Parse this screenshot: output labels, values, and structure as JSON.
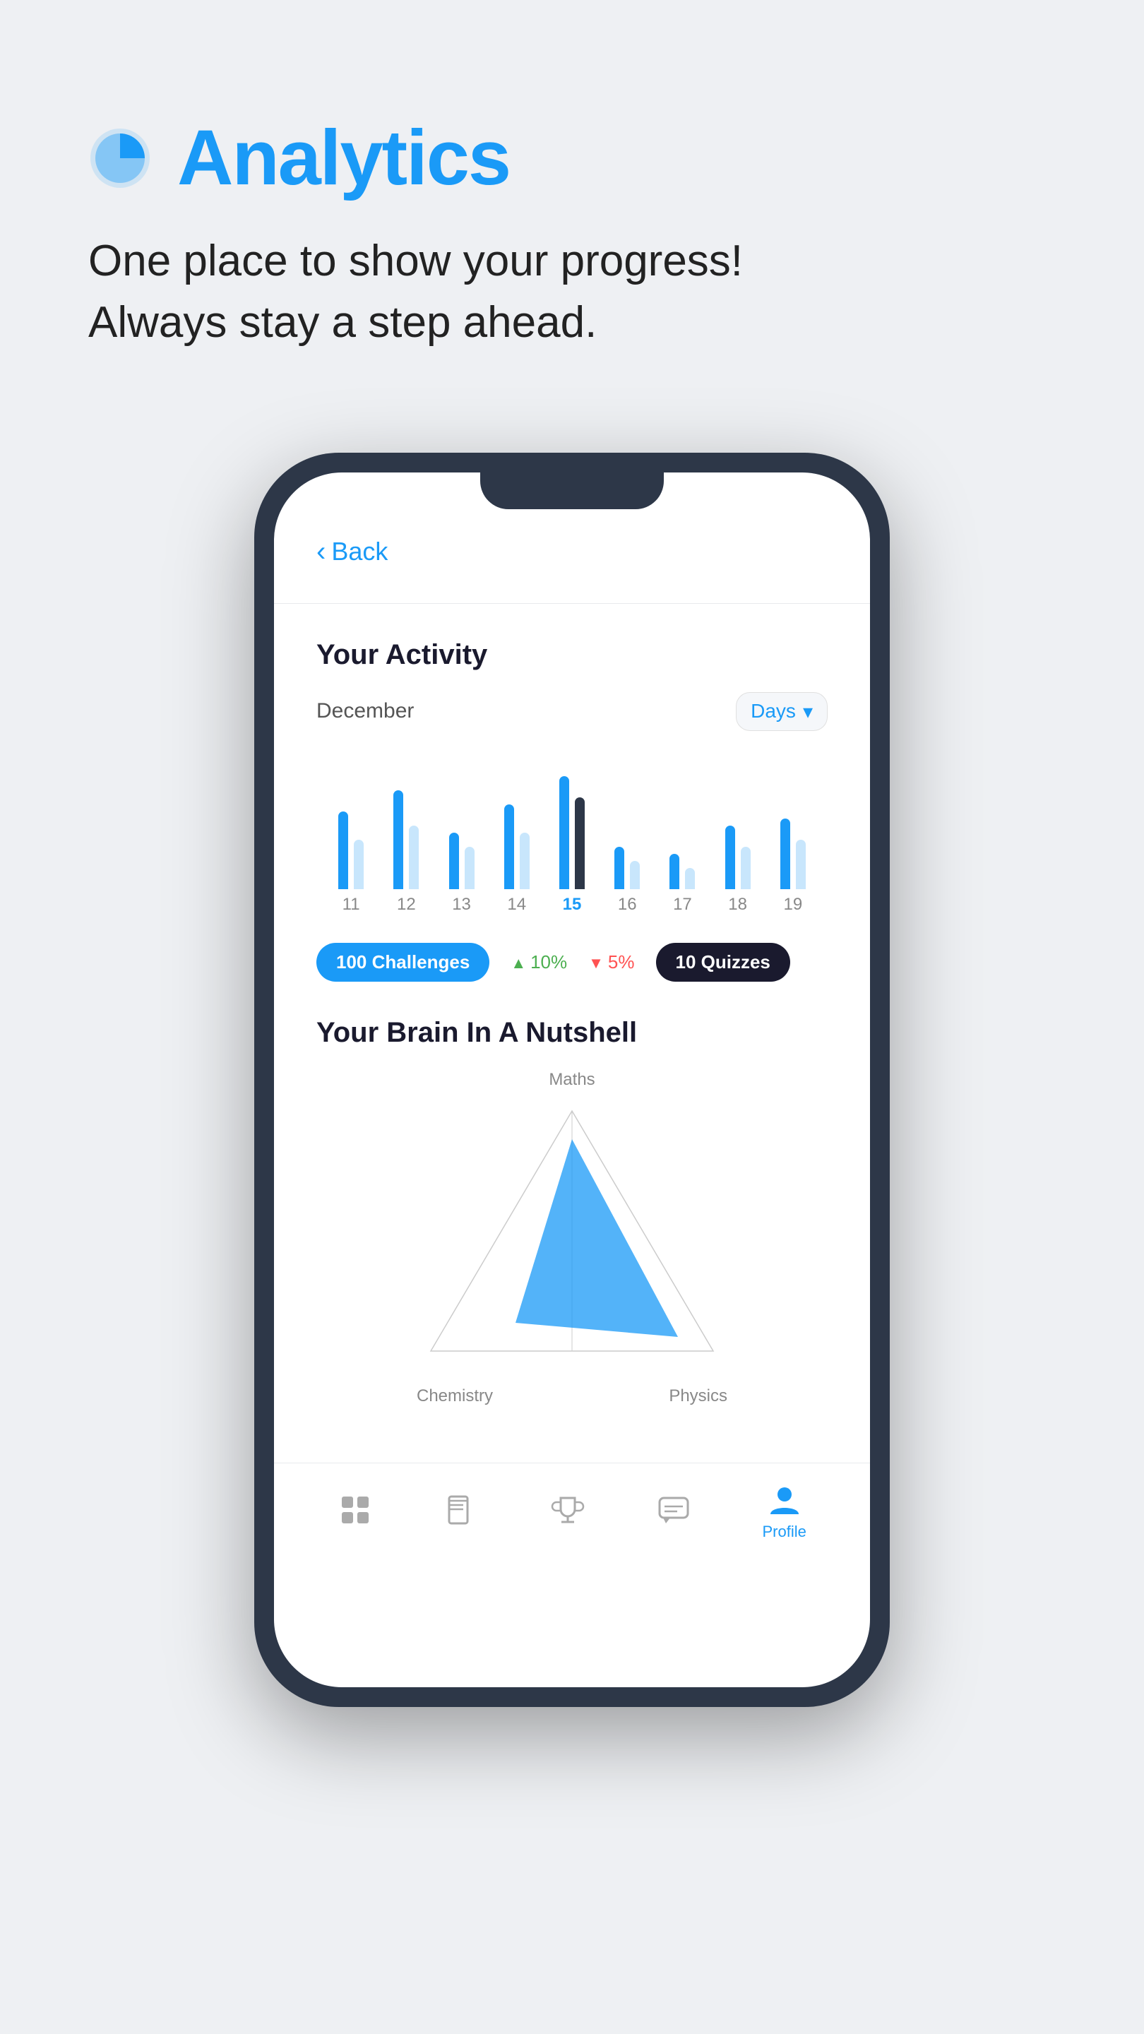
{
  "page": {
    "background": "#eef0f3"
  },
  "header": {
    "icon_label": "analytics-pie-icon",
    "title": "Analytics",
    "subtitle_line1": "One place to show your progress!",
    "subtitle_line2": "Always stay a step ahead."
  },
  "phone": {
    "back_label": "Back",
    "divider": true,
    "activity": {
      "section_title": "Your Activity",
      "month": "December",
      "period_selector": "Days",
      "bars": [
        {
          "day": "11",
          "height_left": 110,
          "height_right": 70,
          "active": false
        },
        {
          "day": "12",
          "height_left": 140,
          "height_right": 90,
          "active": false
        },
        {
          "day": "13",
          "height_left": 80,
          "height_right": 60,
          "active": false
        },
        {
          "day": "14",
          "height_left": 120,
          "height_right": 80,
          "active": false
        },
        {
          "day": "15",
          "height_left": 160,
          "height_right": 130,
          "active": true
        },
        {
          "day": "16",
          "height_left": 60,
          "height_right": 40,
          "active": false
        },
        {
          "day": "17",
          "height_left": 50,
          "height_right": 30,
          "active": false
        },
        {
          "day": "18",
          "height_left": 90,
          "height_right": 60,
          "active": false
        },
        {
          "day": "19",
          "height_left": 100,
          "height_right": 70,
          "active": false
        }
      ],
      "stats": [
        {
          "label": "100 Challenges",
          "type": "badge-blue"
        },
        {
          "label": "10%",
          "type": "change-up"
        },
        {
          "label": "5%",
          "type": "change-down"
        },
        {
          "label": "10 Quizzes",
          "type": "badge-dark"
        }
      ]
    },
    "brain": {
      "section_title": "Your Brain In A Nutshell",
      "radar_labels": {
        "top": "Maths",
        "bottom_left": "Chemistry",
        "bottom_right": "Physics"
      }
    },
    "nav": {
      "items": [
        {
          "label": "",
          "icon": "home-icon",
          "active": false
        },
        {
          "label": "",
          "icon": "book-icon",
          "active": false
        },
        {
          "label": "",
          "icon": "trophy-icon",
          "active": false
        },
        {
          "label": "",
          "icon": "chat-icon",
          "active": false
        },
        {
          "label": "Profile",
          "icon": "profile-icon",
          "active": true
        }
      ]
    }
  }
}
